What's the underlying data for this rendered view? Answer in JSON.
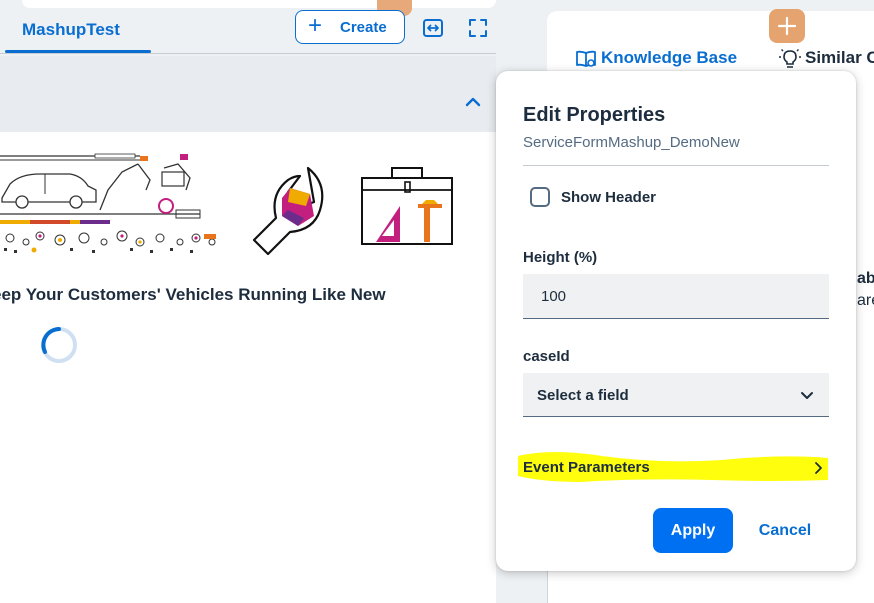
{
  "left": {
    "tab_label": "MashupTest",
    "create_label": "Create",
    "headline": "eep Your Customers' Vehicles Running Like New"
  },
  "right": {
    "kb_tab": "Knowledge Base",
    "similar_tab": "Similar C",
    "partial_1": "abl",
    "partial_2": "are"
  },
  "dialog": {
    "title": "Edit Properties",
    "subtitle": "ServiceFormMashup_DemoNew",
    "show_header_label": "Show Header",
    "height_label": "Height (%)",
    "height_value": "100",
    "caseid_label": "caseId",
    "caseid_select": "Select a field",
    "event_params_label": "Event Parameters",
    "apply_label": "Apply",
    "cancel_label": "Cancel"
  },
  "colors": {
    "accent": "#0a6ed1",
    "primary_button": "#0070f2",
    "highlight": "#ffff00",
    "orange": "#e5a46f"
  }
}
